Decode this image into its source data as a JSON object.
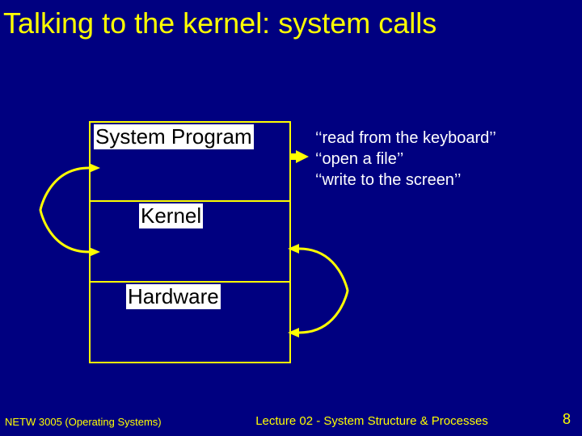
{
  "title": "Talking to the kernel: system calls",
  "boxes": {
    "system_program": "System Program",
    "kernel": "Kernel",
    "hardware": "Hardware"
  },
  "examples": {
    "line1": "‘‘read from the keyboard’’",
    "line2": "‘‘open a file’’",
    "line3": "‘‘write to the screen’’"
  },
  "footer": {
    "left": "NETW 3005 (Operating Systems)",
    "center": "Lecture 02 - System Structure & Processes",
    "page": "8"
  },
  "colors": {
    "bg": "#000080",
    "accent": "#ffff00",
    "text_white": "#ffffff"
  }
}
